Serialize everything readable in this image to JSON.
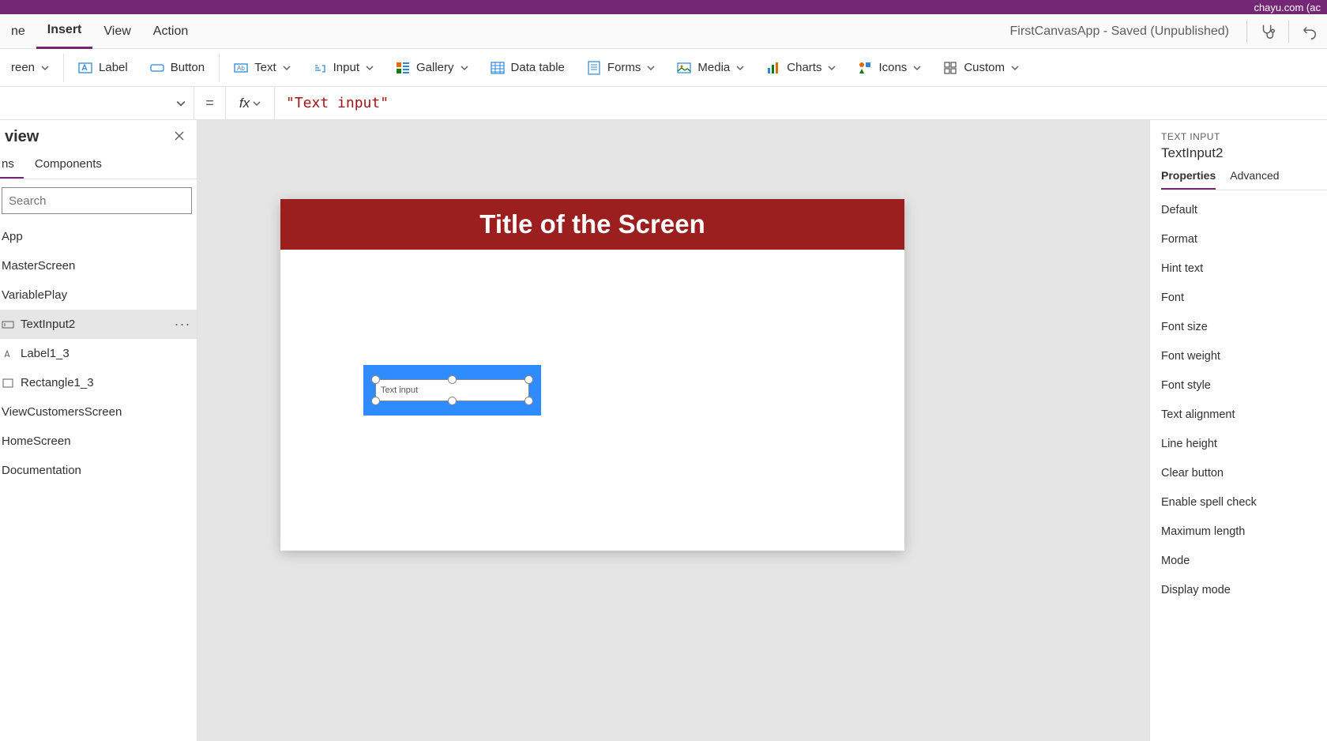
{
  "title_bar_right": "chayu.com (ac",
  "menu": {
    "items": [
      "ne",
      "Insert",
      "View",
      "Action"
    ],
    "active": 1
  },
  "app_status": "FirstCanvasApp - Saved (Unpublished)",
  "ribbon": {
    "screen": "reen",
    "label": "Label",
    "button": "Button",
    "text": "Text",
    "input": "Input",
    "gallery": "Gallery",
    "data_table": "Data table",
    "forms": "Forms",
    "media": "Media",
    "charts": "Charts",
    "icons": "Icons",
    "custom": "Custom"
  },
  "formula": {
    "eq": "=",
    "fx": "fx",
    "value": "\"Text input\""
  },
  "tree": {
    "title": "view",
    "tabs": [
      "ns",
      "Components"
    ],
    "active_tab": 0,
    "search_placeholder": "Search",
    "items": [
      {
        "label": "App"
      },
      {
        "label": "MasterScreen"
      },
      {
        "label": "VariablePlay"
      },
      {
        "label": "TextInput2",
        "selected": true
      },
      {
        "label": "Label1_3"
      },
      {
        "label": "Rectangle1_3"
      },
      {
        "label": "ViewCustomersScreen"
      },
      {
        "label": "HomeScreen"
      },
      {
        "label": "Documentation"
      }
    ]
  },
  "canvas": {
    "screen_title": "Title of the Screen",
    "selected_text": "Text input"
  },
  "props": {
    "type": "TEXT INPUT",
    "name": "TextInput2",
    "tabs": [
      "Properties",
      "Advanced"
    ],
    "active_tab": 0,
    "rows": [
      "Default",
      "Format",
      "Hint text",
      "Font",
      "Font size",
      "Font weight",
      "Font style",
      "Text alignment",
      "Line height",
      "Clear button",
      "Enable spell check",
      "Maximum length",
      "Mode",
      "Display mode"
    ]
  }
}
